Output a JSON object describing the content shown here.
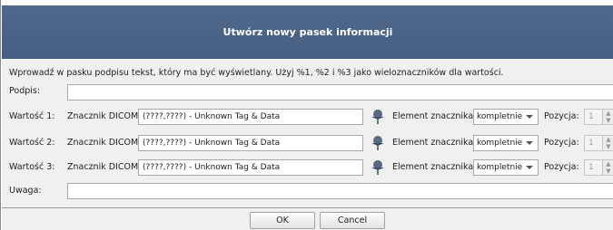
{
  "dialog": {
    "title": "Utwórz nowy pasek informacji",
    "instruction": "Wprowadź w pasku podpisu tekst, który ma być wyświetlany. Użyj %1, %2 i %3 jako wieloznaczników dla wartości.",
    "caption_label": "Podpis:",
    "caption_value": "",
    "note_label": "Uwaga:",
    "note_value": "",
    "values": [
      {
        "label": "Wartość 1:",
        "tag_label": "Znacznik DICOM:",
        "tag_value": "(????,????) - Unknown Tag & Data",
        "picker_icon": "pin-icon",
        "element_label": "Element znacznika:",
        "element_value": "kompletnie",
        "position_label": "Pozycja:",
        "position_value": "1"
      },
      {
        "label": "Wartość 2:",
        "tag_label": "Znacznik DICOM:",
        "tag_value": "(????,????) - Unknown Tag & Data",
        "picker_icon": "pin-icon",
        "element_label": "Element znacznika:",
        "element_value": "kompletnie",
        "position_label": "Pozycja:",
        "position_value": "1"
      },
      {
        "label": "Wartość 3:",
        "tag_label": "Znacznik DICOM:",
        "tag_value": "(????,????) - Unknown Tag & Data",
        "picker_icon": "pin-icon",
        "element_label": "Element znacznika:",
        "element_value": "kompletnie",
        "position_label": "Pozycja:",
        "position_value": "1"
      }
    ],
    "ok_label": "OK",
    "cancel_label": "Cancel"
  },
  "colors": {
    "title_bar": "#4b6487",
    "dialog_bg": "#f0f0f0",
    "pin_icon": "#556b80"
  }
}
